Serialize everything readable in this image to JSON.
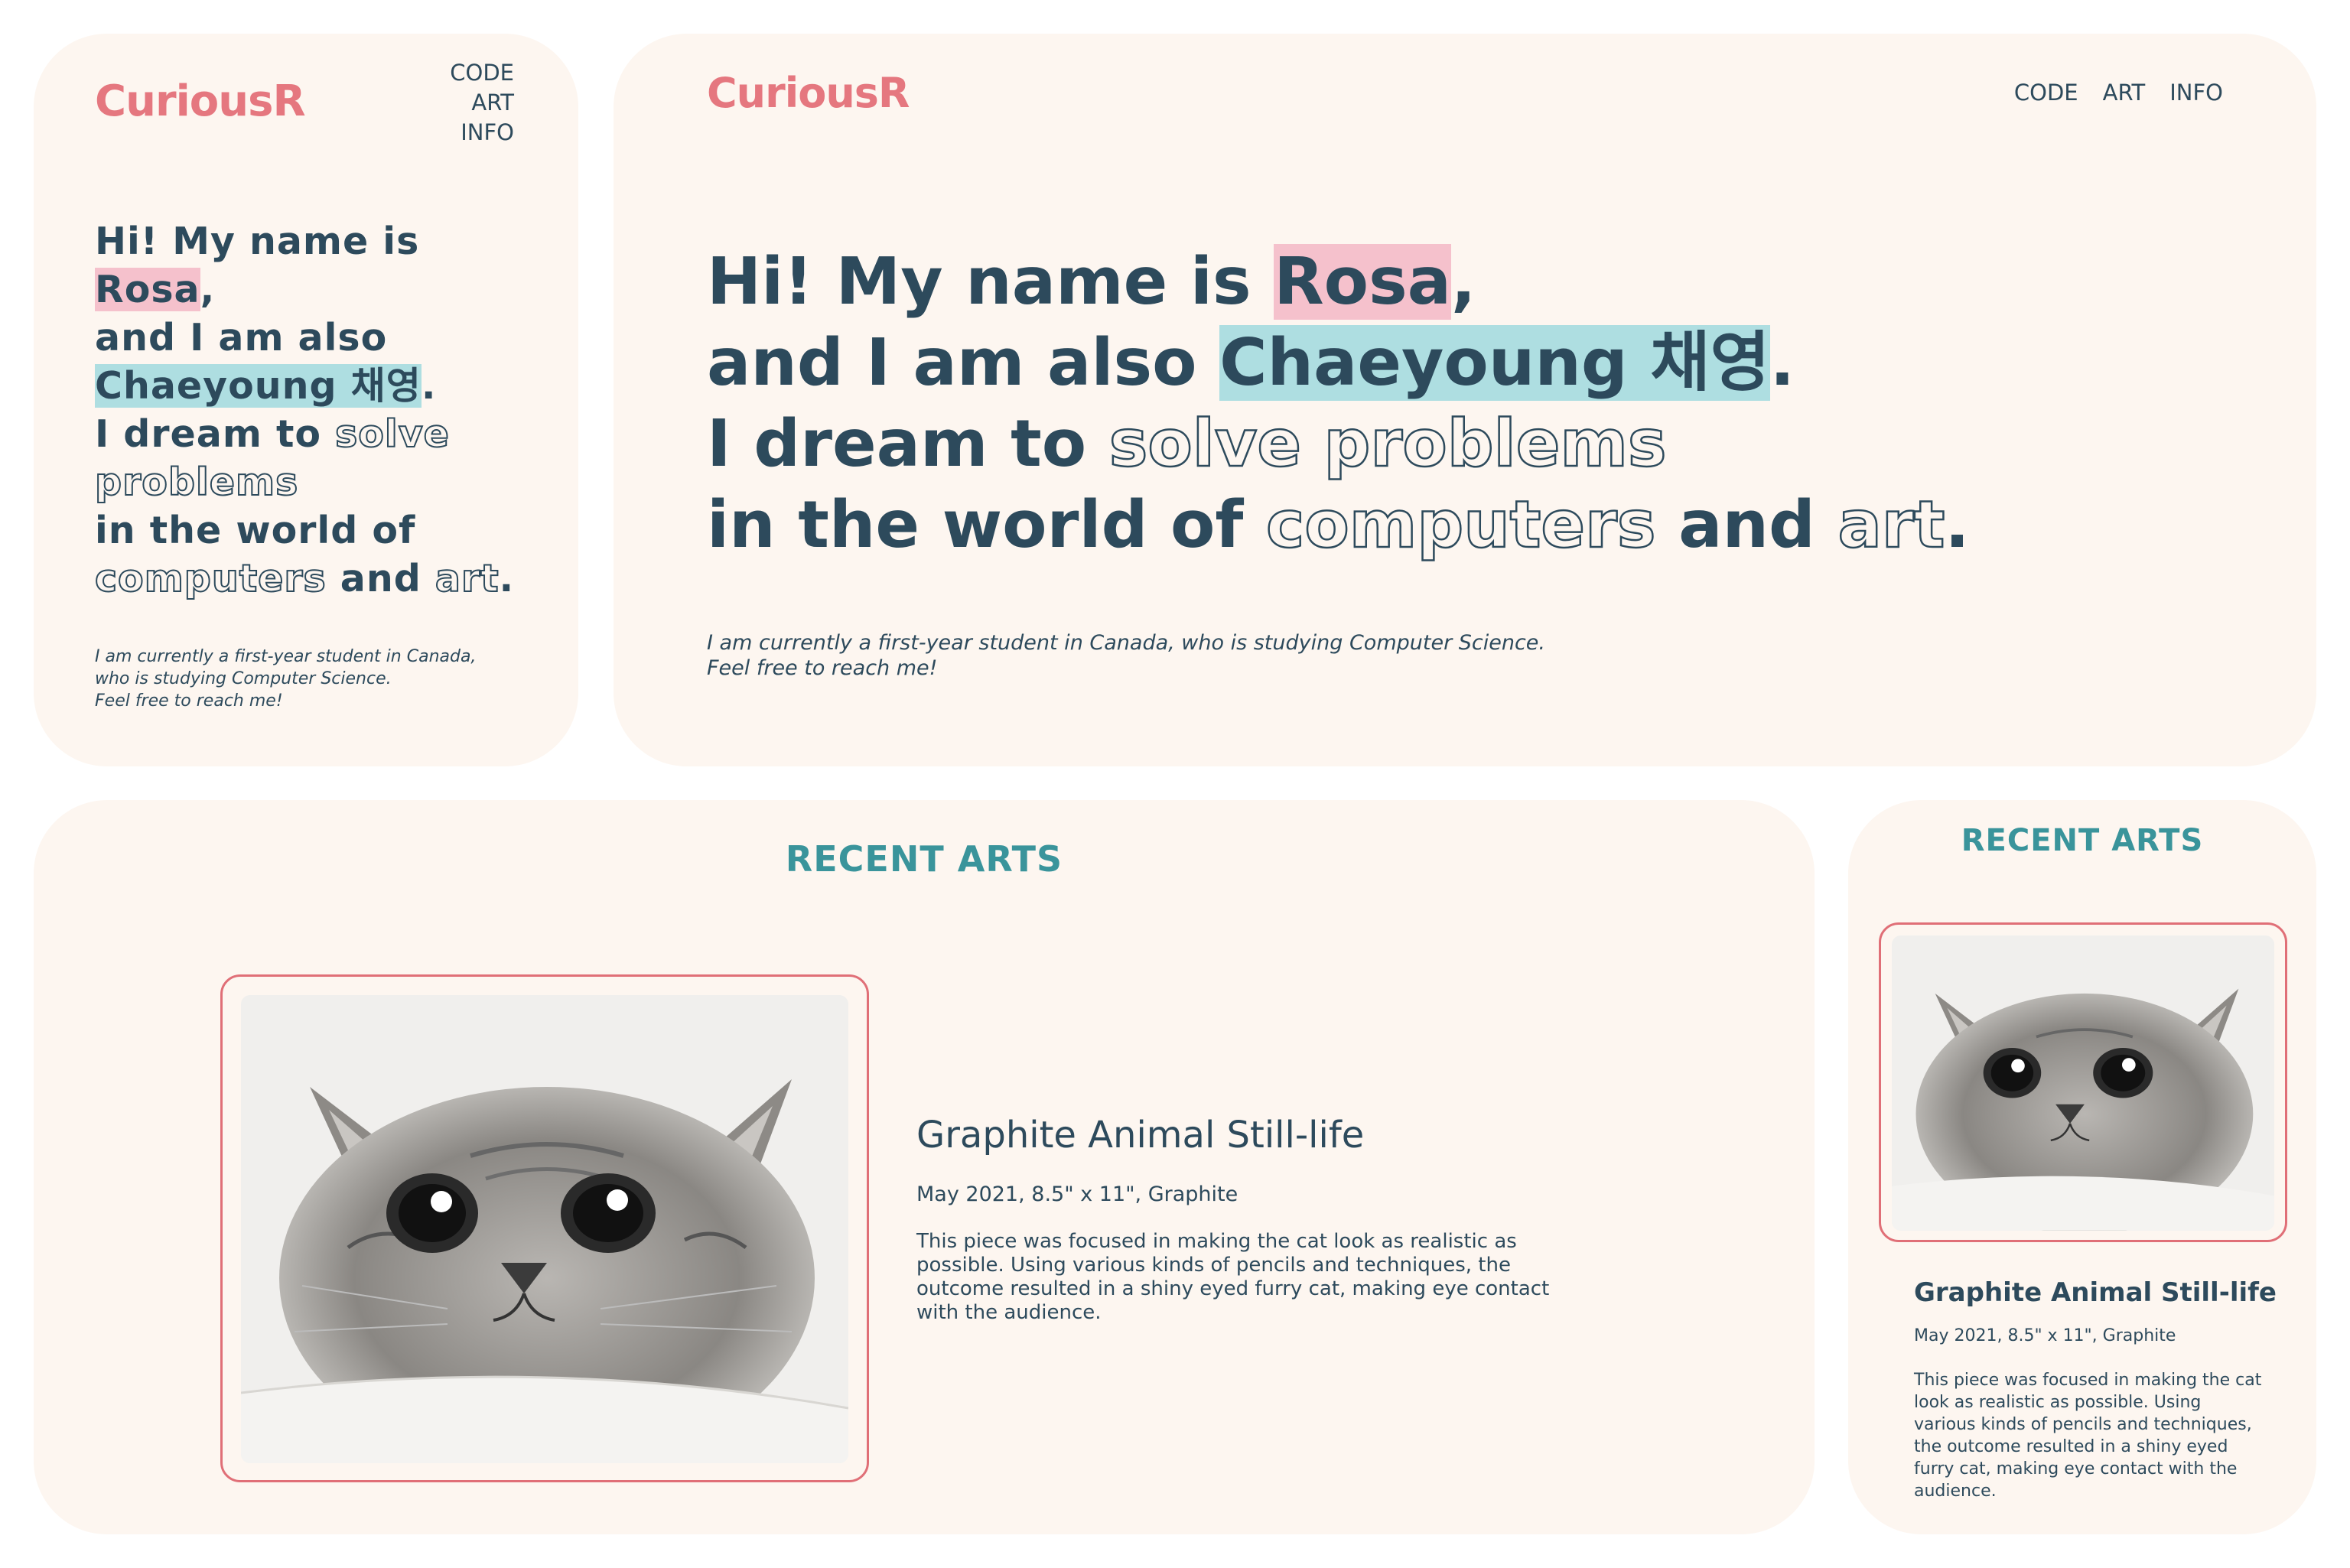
{
  "brand": {
    "logo": "CuriousR",
    "logo_color": "#e5777f"
  },
  "nav": [
    "CODE",
    "ART",
    "INFO"
  ],
  "hero": {
    "line1_prefix": "Hi! My name is ",
    "name": "Rosa",
    "comma": ",",
    "line2_prefix": "and I am also ",
    "alt_name": "Chaeyoung 채영",
    "period": ".",
    "line3_prefix": "I dream to ",
    "outline_1": "solve problems",
    "line4_prefix": "in the world of ",
    "outline_2": "computers",
    "and": " and ",
    "outline_3": "art",
    "end": "."
  },
  "intro": {
    "desktop_line1": "I am currently a first-year student in Canada, who is studying Computer Science.",
    "desktop_line2": "Feel free to reach me!",
    "mobile_line1": "I am currently a first-year student in Canada,",
    "mobile_line2": "who is studying Computer Science.",
    "mobile_line3": "Feel free to reach me!"
  },
  "recent": {
    "heading": "RECENT ARTS",
    "art": {
      "title": "Graphite Animal Still-life",
      "meta": "May 2021, 8.5\" x 11\", Graphite",
      "description": "This piece was focused in making the cat look as realistic as possible. Using various kinds of pencils and techniques, the outcome resulted in a shiny eyed furry cat, making eye contact with the audience.",
      "image_alt": "graphite cat drawing"
    }
  },
  "colors": {
    "panel_bg": "#fdf6f0",
    "text": "#2d4a5c",
    "highlight_pink": "#f5c1cc",
    "highlight_teal": "#aedee1",
    "heading_teal": "#3a949b",
    "frame_red": "#e06f77"
  }
}
